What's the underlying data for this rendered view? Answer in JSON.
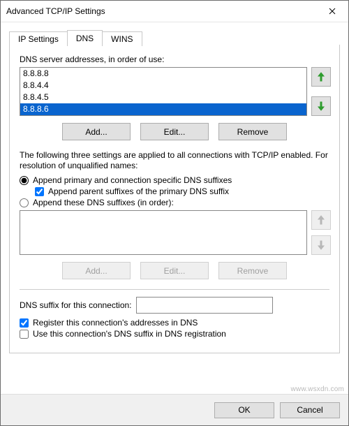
{
  "window": {
    "title": "Advanced TCP/IP Settings"
  },
  "tabs": [
    {
      "label": "IP Settings",
      "active": false
    },
    {
      "label": "DNS",
      "active": true
    },
    {
      "label": "WINS",
      "active": false
    }
  ],
  "dns": {
    "list_label": "DNS server addresses, in order of use:",
    "servers": [
      "8.8.8.8",
      "8.8.4.4",
      "8.8.4.5",
      "8.8.8.6"
    ],
    "selected_index": 3,
    "buttons": {
      "add": "Add...",
      "edit": "Edit...",
      "remove": "Remove"
    },
    "explain": "The following three settings are applied to all connections with TCP/IP enabled. For resolution of unqualified names:",
    "radio1": "Append primary and connection specific DNS suffixes",
    "check_parent": "Append parent suffixes of the primary DNS suffix",
    "radio2": "Append these DNS suffixes (in order):",
    "radio_selected": 1,
    "parent_checked": true,
    "suffix_buttons": {
      "add": "Add...",
      "edit": "Edit...",
      "remove": "Remove"
    },
    "conn_suffix_label": "DNS suffix for this connection:",
    "conn_suffix_value": "",
    "register_label": "Register this connection's addresses in DNS",
    "register_checked": true,
    "use_suffix_label": "Use this connection's DNS suffix in DNS registration",
    "use_suffix_checked": false
  },
  "footer": {
    "ok": "OK",
    "cancel": "Cancel"
  },
  "watermark": "www.wsxdn.com"
}
